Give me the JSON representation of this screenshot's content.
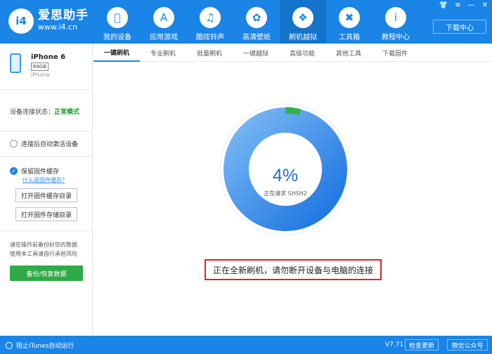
{
  "app": {
    "brand_name": "爱思助手",
    "brand_url": "www.i4.cn",
    "logo_text": "i4"
  },
  "nav": [
    {
      "label": "我的设备",
      "icon": "apple-icon"
    },
    {
      "label": "应用游戏",
      "icon": "app-store-icon"
    },
    {
      "label": "酷炫铃声",
      "icon": "bell-icon"
    },
    {
      "label": "高清壁纸",
      "icon": "flower-icon"
    },
    {
      "label": "刷机越狱",
      "icon": "dropbox-icon"
    },
    {
      "label": "工具箱",
      "icon": "tools-icon"
    },
    {
      "label": "教程中心",
      "icon": "info-icon"
    }
  ],
  "window_controls": [
    "👕",
    "≡",
    "—",
    "✕"
  ],
  "download_center": "下载中心",
  "device": {
    "name": "iPhone 6",
    "capacity": "64GB",
    "type": "iPhone"
  },
  "sidebar": {
    "status_label": "设备连接状态：",
    "status_value": "正常模式",
    "auto_activate": "连接后自动激活设备",
    "keep_firmware": "保留固件缓存",
    "what_is_cache": "什么是固件缓存?",
    "open_cache_dir": "打开固件缓存目录",
    "open_store_dir": "打开固件存储目录",
    "warning_line1": "请在操作前备份好您的数据",
    "warning_line2": "使用本工具请自行承担风险",
    "backup_button": "备份/恢复数据"
  },
  "tabs": [
    "一键刷机",
    "专业刷机",
    "批量刷机",
    "一键越狱",
    "高级功能",
    "其他工具",
    "下载固件"
  ],
  "progress": {
    "percent": 4,
    "percent_text": "4%",
    "status": "正在请求 SHSH2"
  },
  "warning_message": "正在全新刷机，请勿断开设备与电脑的连接",
  "footer": {
    "itunes_toggle": "阻止iTunes自动运行",
    "version": "V7.71",
    "check_update": "检查更新",
    "wechat": "微信公众号"
  },
  "colors": {
    "primary": "#1a85e6",
    "progress_green": "#35b04a",
    "warning_red": "#d9271e",
    "status_green": "#1aa329"
  }
}
